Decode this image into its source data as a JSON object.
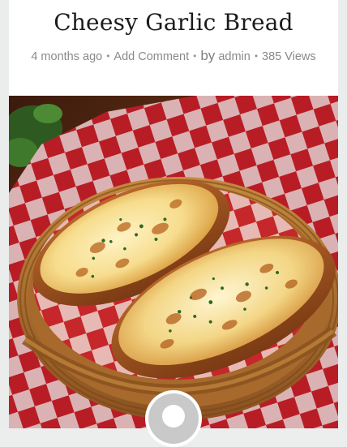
{
  "post": {
    "title": "Cheesy Garlic Bread",
    "meta": {
      "date": "4 months ago",
      "comment_link": "Add Comment",
      "by_label": "by",
      "author": "admin",
      "views": "385 Views",
      "separator": "•"
    },
    "featured_image": {
      "icon": "garlic-bread-photo"
    }
  },
  "author_avatar": {
    "icon": "user-avatar-icon"
  }
}
